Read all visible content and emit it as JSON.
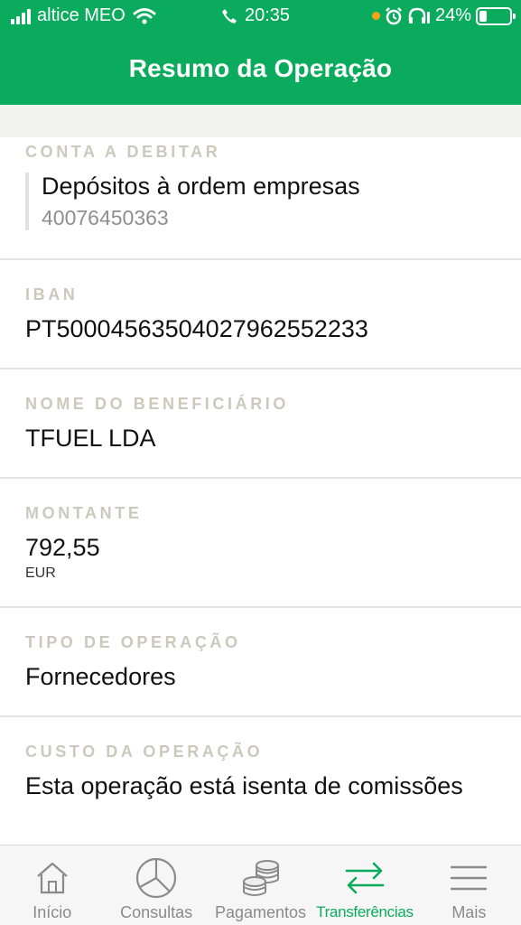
{
  "status_bar": {
    "carrier": "altice MEO",
    "time": "20:35",
    "battery": "24%"
  },
  "header": {
    "title": "Resumo da Operação"
  },
  "account": {
    "label": "CONTA A DEBITAR",
    "name": "Depósitos à ordem empresas",
    "number": "40076450363"
  },
  "iban": {
    "label": "IBAN",
    "value": "PT50004563504027962552233"
  },
  "beneficiary": {
    "label": "NOME DO BENEFICIÁRIO",
    "value": "TFUEL LDA"
  },
  "amount": {
    "label": "MONTANTE",
    "value": "792,55",
    "currency": "EUR"
  },
  "operation_type": {
    "label": "TIPO DE OPERAÇÃO",
    "value": "Fornecedores"
  },
  "operation_cost": {
    "label": "CUSTO DA OPERAÇÃO",
    "value": "Esta operação está isenta de comissões"
  },
  "tabs": [
    {
      "label": "Início",
      "icon": "home-icon"
    },
    {
      "label": "Consultas",
      "icon": "pie-chart-icon"
    },
    {
      "label": "Pagamentos",
      "icon": "coins-icon"
    },
    {
      "label": "Transferências",
      "icon": "transfer-arrows-icon",
      "active": true
    },
    {
      "label": "Mais",
      "icon": "menu-icon"
    }
  ],
  "colors": {
    "brand_green": "#0bab5d",
    "label_beige": "#cdc8bc",
    "tab_inactive": "#8a8a8a"
  }
}
